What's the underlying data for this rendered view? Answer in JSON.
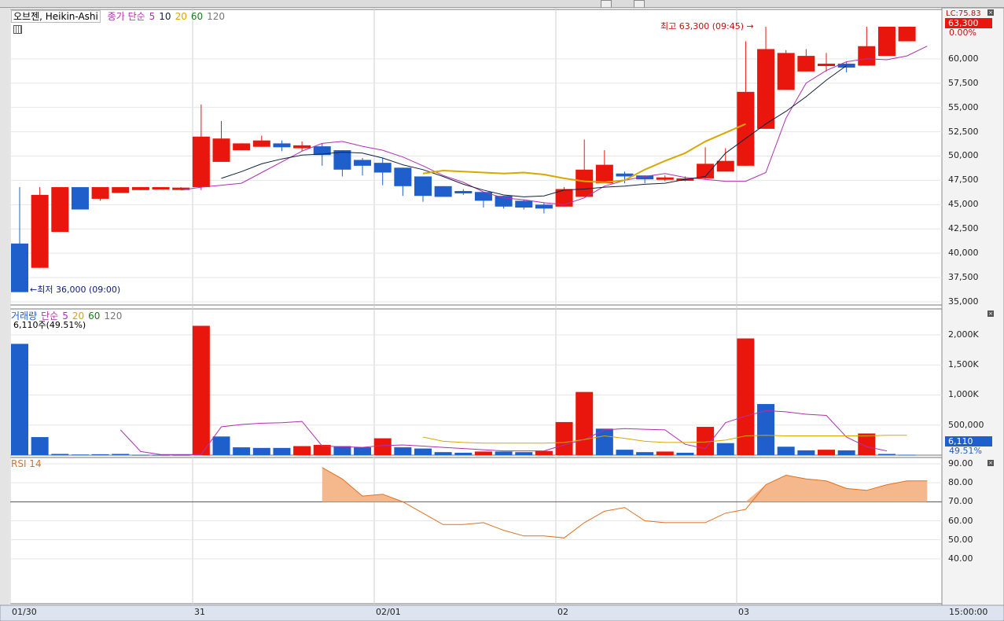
{
  "legend": {
    "title": "오브젠, Heikin-Ashi",
    "ma_prefix": "종가 단순",
    "ma_periods": [
      "5",
      "10",
      "20",
      "60",
      "120"
    ],
    "ma_colors": [
      "#b030b0",
      "#102040",
      "#d8a800",
      "#1a7a1a",
      "#777777"
    ]
  },
  "annotations": {
    "high": "최고 63,300 (09:45)",
    "low": "최저 36,000 (09:00)"
  },
  "price_axis": {
    "ticks": [
      "60,000",
      "57,500",
      "55,000",
      "52,500",
      "50,000",
      "47,500",
      "45,000",
      "42,500",
      "40,000",
      "37,500",
      "35,000"
    ],
    "current_label": "63,300",
    "change_label": "0.00%",
    "lc_label": "LC:75.83"
  },
  "volume": {
    "legend_prefix": "거래량",
    "ma_prefix": "단순",
    "ma_periods": [
      "5",
      "20",
      "60",
      "120"
    ],
    "info": "6,110주(49.51%)",
    "ticks": [
      "2,000K",
      "1,500K",
      "1,000K",
      "500,000"
    ],
    "current_label": "6,110",
    "percent_label": "49.51%"
  },
  "rsi": {
    "label": "RSI 14",
    "ticks": [
      "90.00",
      "80.00",
      "70.00",
      "60.00",
      "50.00",
      "40.00"
    ]
  },
  "time_axis": {
    "labels": [
      "01/30",
      "31",
      "02/01",
      "02",
      "03"
    ],
    "end_label": "15:00:00"
  },
  "colors": {
    "up": "#e8160c",
    "down": "#1f5fcc",
    "ma5": "#b030b0",
    "ma10": "#102040",
    "ma20": "#d8a800",
    "rsi": "#e07020",
    "rsi_fill": "#f5b88c"
  },
  "chart_data": {
    "type": "heikin-ashi candlestick",
    "price_ylim": [
      35000,
      63300
    ],
    "candles": [
      {
        "o": 41000,
        "c": 36000,
        "h": 46800,
        "l": 36000,
        "up": false
      },
      {
        "o": 38500,
        "c": 46000,
        "h": 46800,
        "l": 38500,
        "up": true
      },
      {
        "o": 42200,
        "c": 46800,
        "h": 46800,
        "l": 42200,
        "up": true
      },
      {
        "o": 46800,
        "c": 44500,
        "h": 46800,
        "l": 44500,
        "up": false
      },
      {
        "o": 45600,
        "c": 46800,
        "h": 46800,
        "l": 45400,
        "up": true
      },
      {
        "o": 46200,
        "c": 46800,
        "h": 46800,
        "l": 46200,
        "up": true
      },
      {
        "o": 46500,
        "c": 46800,
        "h": 46800,
        "l": 46500,
        "up": true
      },
      {
        "o": 46650,
        "c": 46800,
        "h": 46800,
        "l": 46650,
        "up": true
      },
      {
        "o": 46700,
        "c": 46750,
        "h": 46800,
        "l": 46700,
        "up": true
      },
      {
        "o": 46800,
        "c": 52000,
        "h": 55300,
        "l": 46500,
        "up": true
      },
      {
        "o": 49400,
        "c": 51800,
        "h": 53600,
        "l": 49400,
        "up": true
      },
      {
        "o": 50600,
        "c": 51300,
        "h": 51300,
        "l": 50600,
        "up": true
      },
      {
        "o": 50950,
        "c": 51600,
        "h": 52100,
        "l": 50950,
        "up": true
      },
      {
        "o": 51300,
        "c": 50900,
        "h": 51600,
        "l": 50500,
        "up": false
      },
      {
        "o": 51100,
        "c": 50800,
        "h": 51500,
        "l": 50500,
        "up": true
      },
      {
        "o": 51000,
        "c": 50100,
        "h": 51300,
        "l": 49000,
        "up": false
      },
      {
        "o": 50600,
        "c": 48600,
        "h": 50600,
        "l": 47900,
        "up": false
      },
      {
        "o": 49600,
        "c": 49000,
        "h": 49800,
        "l": 48000,
        "up": false
      },
      {
        "o": 49300,
        "c": 48300,
        "h": 49800,
        "l": 47000,
        "up": false
      },
      {
        "o": 48800,
        "c": 46900,
        "h": 48800,
        "l": 45900,
        "up": false
      },
      {
        "o": 47900,
        "c": 45900,
        "h": 47900,
        "l": 45300,
        "up": false
      },
      {
        "o": 46900,
        "c": 45800,
        "h": 46900,
        "l": 45800,
        "up": false
      },
      {
        "o": 46400,
        "c": 46200,
        "h": 46600,
        "l": 46000,
        "up": false
      },
      {
        "o": 46300,
        "c": 45400,
        "h": 46300,
        "l": 44700,
        "up": false
      },
      {
        "o": 45900,
        "c": 44800,
        "h": 45900,
        "l": 44600,
        "up": false
      },
      {
        "o": 45400,
        "c": 44700,
        "h": 45500,
        "l": 44500,
        "up": false
      },
      {
        "o": 45000,
        "c": 44600,
        "h": 45200,
        "l": 44100,
        "up": false
      },
      {
        "o": 44800,
        "c": 46600,
        "h": 46800,
        "l": 44800,
        "up": true
      },
      {
        "o": 45800,
        "c": 48600,
        "h": 51700,
        "l": 45800,
        "up": true
      },
      {
        "o": 47200,
        "c": 49100,
        "h": 50600,
        "l": 47200,
        "up": true
      },
      {
        "o": 48200,
        "c": 47900,
        "h": 48400,
        "l": 47200,
        "up": false
      },
      {
        "o": 48000,
        "c": 47600,
        "h": 48000,
        "l": 47200,
        "up": false
      },
      {
        "o": 47800,
        "c": 47700,
        "h": 48000,
        "l": 47400,
        "up": true
      },
      {
        "o": 47700,
        "c": 47600,
        "h": 47900,
        "l": 47400,
        "up": true
      },
      {
        "o": 47700,
        "c": 49200,
        "h": 50900,
        "l": 47600,
        "up": true
      },
      {
        "o": 48400,
        "c": 49500,
        "h": 50800,
        "l": 48400,
        "up": true
      },
      {
        "o": 49000,
        "c": 56600,
        "h": 61800,
        "l": 49000,
        "up": true
      },
      {
        "o": 52800,
        "c": 61000,
        "h": 63300,
        "l": 52800,
        "up": true
      },
      {
        "o": 56800,
        "c": 60600,
        "h": 60900,
        "l": 56800,
        "up": true
      },
      {
        "o": 58700,
        "c": 60300,
        "h": 61000,
        "l": 58700,
        "up": true
      },
      {
        "o": 59500,
        "c": 59500,
        "h": 60600,
        "l": 58700,
        "up": true
      },
      {
        "o": 59500,
        "c": 59100,
        "h": 59700,
        "l": 58600,
        "up": false
      },
      {
        "o": 59300,
        "c": 61300,
        "h": 63300,
        "l": 59300,
        "up": true
      },
      {
        "o": 60300,
        "c": 63300,
        "h": 63300,
        "l": 60300,
        "up": true
      },
      {
        "o": 61800,
        "c": 63300,
        "h": 63300,
        "l": 61800,
        "up": true
      }
    ],
    "ma5": [
      [
        15,
        46500
      ],
      [
        16,
        46800
      ],
      [
        17,
        47000
      ],
      [
        18,
        47200
      ],
      [
        19,
        48300
      ],
      [
        20,
        49400
      ],
      [
        21,
        50500
      ],
      [
        22,
        51300
      ],
      [
        23,
        51500
      ],
      [
        24,
        51000
      ],
      [
        25,
        50600
      ],
      [
        26,
        49900
      ],
      [
        27,
        49000
      ],
      [
        28,
        48000
      ],
      [
        29,
        47300
      ],
      [
        30,
        46300
      ],
      [
        31,
        45700
      ],
      [
        32,
        45500
      ],
      [
        33,
        45200
      ],
      [
        34,
        45000
      ],
      [
        35,
        45700
      ],
      [
        36,
        46900
      ],
      [
        37,
        47500
      ],
      [
        38,
        47900
      ],
      [
        39,
        48200
      ],
      [
        40,
        47800
      ],
      [
        41,
        47600
      ],
      [
        42,
        47400
      ],
      [
        43,
        47400
      ],
      [
        44,
        48300
      ],
      [
        45,
        53900
      ],
      [
        46,
        57500
      ],
      [
        47,
        58800
      ],
      [
        48,
        59700
      ],
      [
        49,
        60000
      ],
      [
        50,
        59900
      ],
      [
        51,
        60300
      ],
      [
        52,
        61300
      ]
    ],
    "ma10": [
      [
        20,
        47700
      ],
      [
        21,
        48400
      ],
      [
        22,
        49200
      ],
      [
        23,
        49700
      ],
      [
        24,
        50100
      ],
      [
        25,
        50200
      ],
      [
        26,
        50400
      ],
      [
        27,
        50300
      ],
      [
        28,
        49800
      ],
      [
        29,
        49100
      ],
      [
        30,
        48600
      ],
      [
        31,
        47900
      ],
      [
        32,
        47100
      ],
      [
        33,
        46500
      ],
      [
        34,
        46000
      ],
      [
        35,
        45800
      ],
      [
        36,
        45900
      ],
      [
        37,
        46500
      ],
      [
        38,
        46600
      ],
      [
        39,
        46800
      ],
      [
        40,
        46900
      ],
      [
        41,
        47100
      ],
      [
        42,
        47200
      ],
      [
        43,
        47600
      ],
      [
        44,
        47900
      ],
      [
        45,
        50300
      ],
      [
        46,
        51800
      ],
      [
        47,
        53300
      ],
      [
        48,
        54600
      ],
      [
        49,
        56100
      ],
      [
        50,
        57800
      ],
      [
        51,
        59300
      ]
    ],
    "ma20": [
      [
        31,
        48200
      ],
      [
        32,
        48500
      ],
      [
        33,
        48400
      ],
      [
        34,
        48300
      ],
      [
        35,
        48200
      ],
      [
        36,
        48300
      ],
      [
        37,
        48100
      ],
      [
        38,
        47700
      ],
      [
        39,
        47400
      ],
      [
        40,
        47300
      ],
      [
        41,
        47500
      ],
      [
        42,
        48600
      ],
      [
        43,
        49500
      ],
      [
        44,
        50300
      ],
      [
        45,
        51500
      ],
      [
        46,
        52400
      ],
      [
        47,
        53300
      ]
    ],
    "volume_ylim": [
      0,
      2300000
    ],
    "volume": [
      1850000,
      300000,
      20000,
      10000,
      15000,
      20000,
      5000,
      5000,
      5000,
      2150000,
      310000,
      130000,
      120000,
      120000,
      150000,
      170000,
      150000,
      130000,
      280000,
      130000,
      110000,
      50000,
      40000,
      60000,
      60000,
      50000,
      70000,
      550000,
      1050000,
      440000,
      90000,
      50000,
      60000,
      40000,
      470000,
      200000,
      1940000,
      850000,
      140000,
      80000,
      90000,
      80000,
      360000,
      20000,
      6110
    ],
    "volume_up": [
      false,
      false,
      false,
      false,
      false,
      false,
      false,
      false,
      false,
      true,
      false,
      false,
      false,
      false,
      true,
      true,
      false,
      false,
      true,
      false,
      false,
      false,
      false,
      true,
      false,
      false,
      true,
      true,
      true,
      false,
      false,
      false,
      true,
      false,
      true,
      false,
      true,
      false,
      false,
      false,
      true,
      false,
      true,
      false,
      false
    ],
    "volume_ma5": [
      [
        5,
        420000
      ],
      [
        6,
        60000
      ],
      [
        7,
        10000
      ],
      [
        8,
        10000
      ],
      [
        9,
        10000
      ],
      [
        10,
        470000
      ],
      [
        11,
        510000
      ],
      [
        12,
        530000
      ],
      [
        13,
        540000
      ],
      [
        14,
        560000
      ],
      [
        15,
        150000
      ],
      [
        16,
        140000
      ],
      [
        17,
        130000
      ],
      [
        18,
        160000
      ],
      [
        19,
        170000
      ],
      [
        20,
        150000
      ],
      [
        21,
        130000
      ],
      [
        22,
        110000
      ],
      [
        23,
        90000
      ],
      [
        24,
        70000
      ],
      [
        25,
        70000
      ],
      [
        26,
        70000
      ],
      [
        27,
        170000
      ],
      [
        28,
        260000
      ],
      [
        29,
        420000
      ],
      [
        30,
        440000
      ],
      [
        31,
        430000
      ],
      [
        32,
        420000
      ],
      [
        33,
        180000
      ],
      [
        34,
        110000
      ],
      [
        35,
        540000
      ],
      [
        36,
        650000
      ],
      [
        37,
        740000
      ],
      [
        38,
        720000
      ],
      [
        39,
        680000
      ],
      [
        40,
        660000
      ],
      [
        41,
        300000
      ],
      [
        42,
        140000
      ],
      [
        43,
        70000
      ]
    ],
    "volume_ma20": [
      [
        20,
        300000
      ],
      [
        21,
        230000
      ],
      [
        22,
        210000
      ],
      [
        23,
        200000
      ],
      [
        24,
        200000
      ],
      [
        25,
        200000
      ],
      [
        26,
        200000
      ],
      [
        27,
        210000
      ],
      [
        28,
        260000
      ],
      [
        29,
        320000
      ],
      [
        30,
        280000
      ],
      [
        31,
        230000
      ],
      [
        32,
        210000
      ],
      [
        33,
        210000
      ],
      [
        34,
        220000
      ],
      [
        35,
        250000
      ],
      [
        36,
        320000
      ],
      [
        37,
        330000
      ],
      [
        38,
        320000
      ],
      [
        39,
        320000
      ],
      [
        40,
        320000
      ],
      [
        41,
        320000
      ],
      [
        42,
        320000
      ],
      [
        43,
        330000
      ],
      [
        44,
        330000
      ]
    ],
    "rsi_ylim": [
      30,
      90
    ],
    "rsi_ref": 70,
    "rsi": [
      [
        15,
        88
      ],
      [
        16,
        82
      ],
      [
        17,
        73
      ],
      [
        18,
        74
      ],
      [
        19,
        70
      ],
      [
        20,
        64
      ],
      [
        21,
        58
      ],
      [
        22,
        58
      ],
      [
        23,
        59
      ],
      [
        24,
        55
      ],
      [
        25,
        52
      ],
      [
        26,
        52
      ],
      [
        27,
        51
      ],
      [
        28,
        59
      ],
      [
        29,
        65
      ],
      [
        30,
        67
      ],
      [
        31,
        60
      ],
      [
        32,
        59
      ],
      [
        33,
        59
      ],
      [
        34,
        59
      ],
      [
        35,
        64
      ],
      [
        36,
        66
      ],
      [
        37,
        79
      ],
      [
        38,
        84
      ],
      [
        39,
        82
      ],
      [
        40,
        81
      ],
      [
        41,
        77
      ],
      [
        42,
        76
      ],
      [
        43,
        79
      ],
      [
        44,
        81
      ],
      [
        45,
        81
      ]
    ]
  }
}
